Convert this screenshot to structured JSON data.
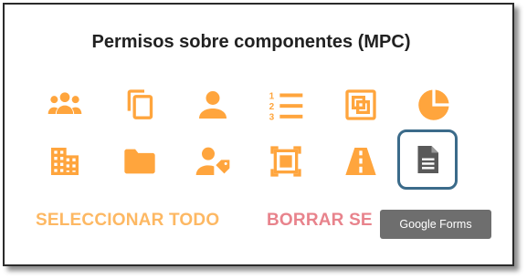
{
  "panel": {
    "title": "Permisos sobre componentes (MPC)"
  },
  "icons": [
    {
      "name": "groups-icon"
    },
    {
      "name": "copy-icon"
    },
    {
      "name": "person-icon"
    },
    {
      "name": "numbered-list-icon"
    },
    {
      "name": "photo-filter-icon"
    },
    {
      "name": "pie-chart-icon"
    },
    {
      "name": "building-icon"
    },
    {
      "name": "folder-icon"
    },
    {
      "name": "person-tag-icon"
    },
    {
      "name": "crop-frame-icon"
    },
    {
      "name": "road-icon"
    },
    {
      "name": "google-forms-icon"
    }
  ],
  "actions": {
    "select_all": "SELECCIONAR TODO",
    "clear_all": "BORRAR SE"
  },
  "tooltip": {
    "text": "Google Forms"
  },
  "colors": {
    "accent": "#FFA53D",
    "accent_soft": "#FDB863",
    "clear_red": "#E8838C",
    "selected_icon": "#595959",
    "selected_border": "#3B6B8A",
    "tooltip_bg": "#6E6E6E"
  }
}
